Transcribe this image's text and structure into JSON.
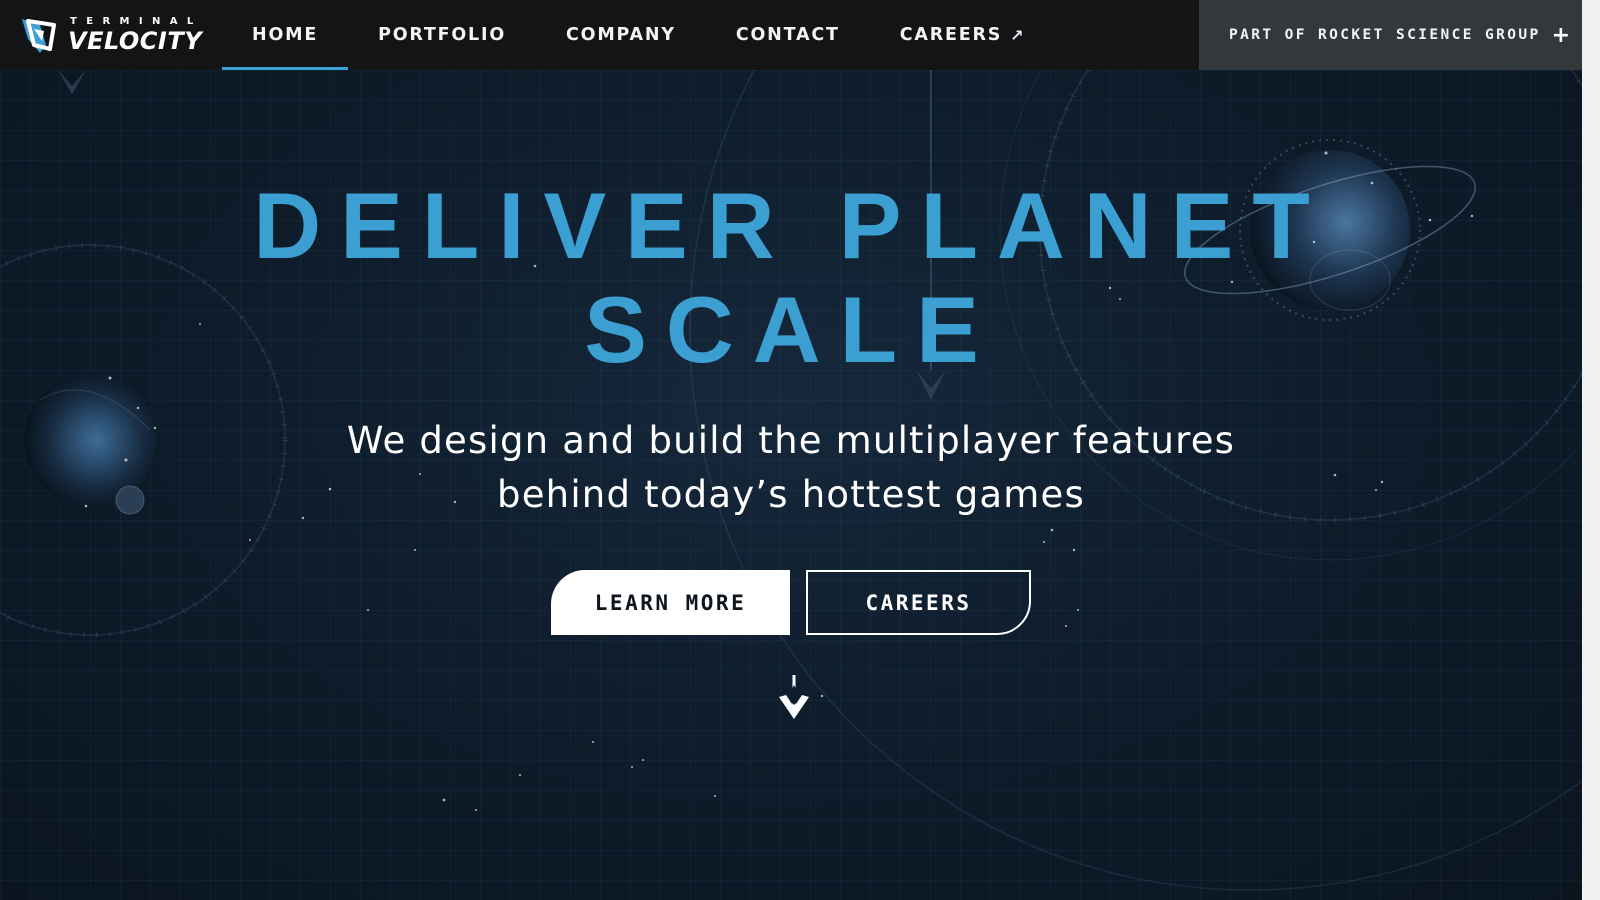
{
  "brand": {
    "name_top": "TERMINAL",
    "name_bottom": "VELOCITY",
    "logo_icon": "terminal-velocity-logo-icon"
  },
  "nav": {
    "items": [
      {
        "label": "HOME",
        "active": true
      },
      {
        "label": "PORTFOLIO",
        "active": false
      },
      {
        "label": "COMPANY",
        "active": false
      },
      {
        "label": "CONTACT",
        "active": false
      },
      {
        "label": "CAREERS",
        "active": false,
        "external": true
      }
    ],
    "external_icon": "external-arrow-icon",
    "group": {
      "label": "PART OF ROCKET SCIENCE GROUP",
      "icon": "plus-icon"
    }
  },
  "hero": {
    "headline_line1": "DELIVER PLANET",
    "headline_line2": "SCALE",
    "subhead_line1": "We design and build the multiplayer features",
    "subhead_line2": "behind today’s hottest games",
    "primary_button": "LEARN MORE",
    "secondary_button": "CAREERS",
    "scroll_icon": "scroll-down-arrow-icon"
  },
  "colors": {
    "accent": "#3b9fd2",
    "nav_bg": "#121416",
    "badge_bg": "#33383d",
    "hero_bg": "#0e1d2c"
  }
}
